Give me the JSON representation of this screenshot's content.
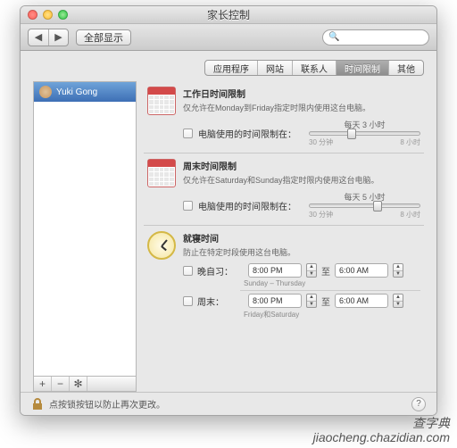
{
  "window": {
    "title": "家长控制"
  },
  "toolbar": {
    "back": "◀",
    "forward": "▶",
    "showall": "全部显示"
  },
  "tabs": [
    "应用程序",
    "网站",
    "联系人",
    "时间限制",
    "其他"
  ],
  "active_tab": 3,
  "sidebar": {
    "user": "Yuki Gong",
    "add": "+",
    "remove": "−",
    "gear": "✻"
  },
  "weekday": {
    "title": "工作日时间限制",
    "desc": "仅允许在Monday到Friday指定时限内使用这台电脑。",
    "limit_label": "电脑使用的时间限制在：",
    "slider_value": "每天 3 小时",
    "min": "30 分钟",
    "max": "8 小时",
    "thumb_pct": 34
  },
  "weekend": {
    "title": "周末时间限制",
    "desc": "仅允许在Saturday和Sunday指定时限内使用这台电脑。",
    "limit_label": "电脑使用的时间限制在：",
    "slider_value": "每天 5 小时",
    "min": "30 分钟",
    "max": "8 小时",
    "thumb_pct": 58
  },
  "bedtime": {
    "title": "就寝时间",
    "desc": "防止在特定时段使用这台电脑。",
    "rows": [
      {
        "label": "晚自习：",
        "start": "8:00 PM",
        "end": "6:00 AM",
        "sub": "Sunday – Thursday"
      },
      {
        "label": "周末：",
        "start": "8:00 PM",
        "end": "6:00 AM",
        "sub": "Friday和Saturday"
      }
    ],
    "to": "至"
  },
  "footer": {
    "lock_text": "点按锁按钮以防止再次更改。",
    "help": "?"
  },
  "watermark": "查字典\njiaocheng.chazidian.com"
}
